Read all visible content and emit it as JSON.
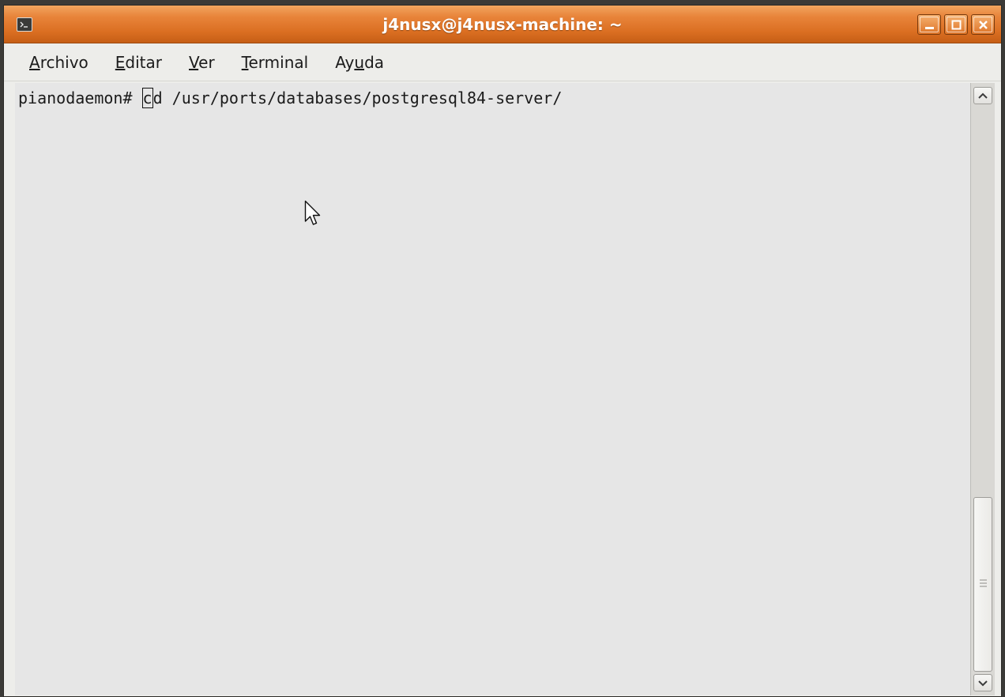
{
  "window": {
    "title": "j4nusx@j4nusx-machine: ~",
    "icon": "terminal-icon",
    "buttons": [
      "minimize-icon",
      "maximize-icon",
      "close-icon"
    ]
  },
  "menu": {
    "items": [
      {
        "pre": "",
        "mnemonic": "A",
        "post": "rchivo"
      },
      {
        "pre": "",
        "mnemonic": "E",
        "post": "ditar"
      },
      {
        "pre": "",
        "mnemonic": "V",
        "post": "er"
      },
      {
        "pre": "",
        "mnemonic": "T",
        "post": "erminal"
      },
      {
        "pre": "Ay",
        "mnemonic": "u",
        "post": "da"
      }
    ]
  },
  "terminal": {
    "prompt": "pianodaemon# ",
    "cursor_char": "c",
    "command_rest": "d /usr/ports/databases/postgresql84-server/"
  },
  "colors": {
    "titlebar": "#e07a2e",
    "terminal_bg": "#e6e6e6",
    "text": "#1a1a1a"
  }
}
